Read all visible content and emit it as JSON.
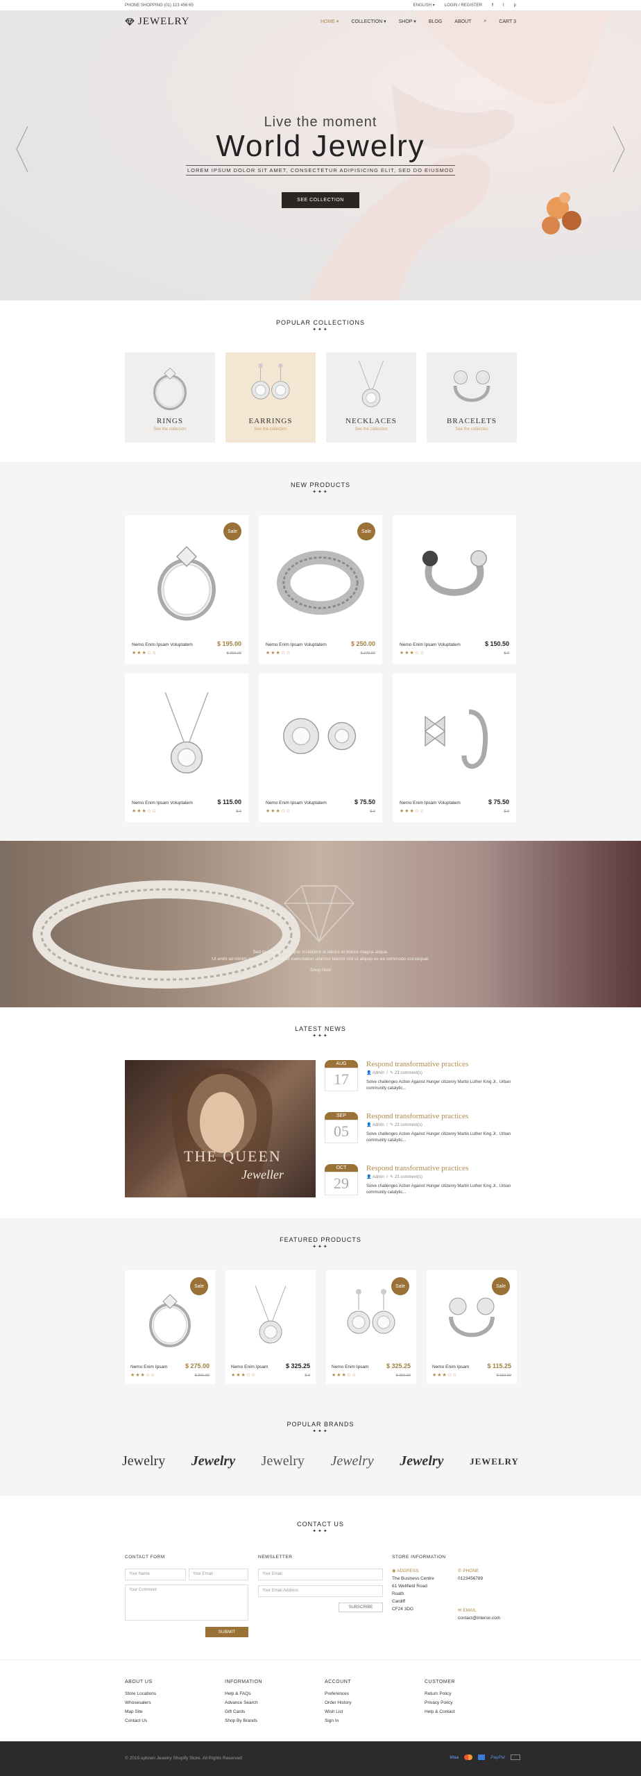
{
  "topbar": {
    "phone": "PHONE SHOPPING (01) 123 456 65",
    "language": "ENGLISH",
    "login": "LOGIN / REGISTER"
  },
  "logo": {
    "text": "JEWELRY"
  },
  "menu": {
    "home": "HOME",
    "collection": "COLLECTION",
    "shop": "SHOP",
    "blog": "BLOG",
    "about": "ABOUT",
    "cart": "CART",
    "cart_count": "3"
  },
  "hero": {
    "subtitle": "Live the moment",
    "title": "World Jewelry",
    "tagline": "LOREM IPSUM DOLOR SIT AMET, CONSECTETUR ADIPISICING ELIT, SED DO EIUSMOD",
    "button": "SEE COLLECTION"
  },
  "popular_collections": {
    "title": "POPULAR COLLECTIONS",
    "items": [
      {
        "name": "RINGS",
        "link": "See the collection"
      },
      {
        "name": "EARRINGS",
        "link": "See the collection"
      },
      {
        "name": "NECKLACES",
        "link": "See the collection"
      },
      {
        "name": "BRACELETS",
        "link": "See the collection"
      }
    ]
  },
  "new_products": {
    "title": "NEW PRODUCTS",
    "items": [
      {
        "name": "Nemo Enim Ipsam Voluptatem",
        "price": "$ 195.00",
        "old": "$ 250.00",
        "badge": "Sale",
        "gold": true
      },
      {
        "name": "Nemo Enim Ipsam Voluptatem",
        "price": "$ 250.00",
        "old": "$ 270.00",
        "badge": "Sale",
        "gold": true
      },
      {
        "name": "Nemo Enim Ipsam Voluptatem",
        "price": "$ 150.50",
        "old": "$ 0",
        "badge": "",
        "gold": false
      },
      {
        "name": "Nemo Enim Ipsam Voluptatem",
        "price": "$ 115.00",
        "old": "$ 0",
        "badge": "",
        "gold": false
      },
      {
        "name": "Nemo Enim Ipsam Voluptatem",
        "price": "$ 75.50",
        "old": "$ 0",
        "badge": "",
        "gold": false
      },
      {
        "name": "Nemo Enim Ipsam Voluptatem",
        "price": "$ 75.50",
        "old": "$ 0",
        "badge": "",
        "gold": false
      }
    ]
  },
  "banner": {
    "line1": "Sed do eiusmod tempor incididunt ut labore et dolore magna aliqua.",
    "line2": "Ut enim ad minim veniam, quis nostrud exercitation ullamco laboris nisi ut aliquip ex ea commodo consequat.",
    "link": "Shop Now"
  },
  "latest_news": {
    "title": "LATEST NEWS",
    "image_text1": "THE QUEEN",
    "image_text2": "Jeweller",
    "items": [
      {
        "month": "AUG",
        "day": "17",
        "title": "Respond transformative practices",
        "author": "Admin",
        "comments": "23 comment(s)",
        "excerpt": "Solve challenges Action Against Hunger citizenry Martin Luther King Jr.. Urban community catalytic..."
      },
      {
        "month": "SEP",
        "day": "05",
        "title": "Respond transformative practices",
        "author": "Admin",
        "comments": "23 comment(s)",
        "excerpt": "Solve challenges Action Against Hunger citizenry Martin Luther King Jr.. Urban community catalytic..."
      },
      {
        "month": "OCT",
        "day": "29",
        "title": "Respond transformative practices",
        "author": "Admin",
        "comments": "23 comment(s)",
        "excerpt": "Solve challenges Action Against Hunger citizenry Martin Luther King Jr.. Urban community catalytic..."
      }
    ]
  },
  "featured_products": {
    "title": "FEATURED PRODUCTS",
    "items": [
      {
        "name": "Nemo Enim Ipsam",
        "price": "$ 275.00",
        "old": "$ 300.00",
        "badge": "Sale",
        "gold": true
      },
      {
        "name": "Nemo Enim Ipsam",
        "price": "$ 325.25",
        "old": "$ 0",
        "badge": "",
        "gold": false
      },
      {
        "name": "Nemo Enim Ipsam",
        "price": "$ 325.25",
        "old": "$ 350.00",
        "badge": "Sale",
        "gold": true
      },
      {
        "name": "Nemo Enim Ipsam",
        "price": "$ 115.25",
        "old": "$ 150.00",
        "badge": "Sale",
        "gold": true
      }
    ]
  },
  "popular_brands": {
    "title": "POPULAR BRANDS",
    "items": [
      "Jewelry",
      "Jewelry",
      "Jewelry",
      "Jewelry",
      "Jewelry",
      "JEWELRY"
    ]
  },
  "contact": {
    "title": "CONTACT US",
    "form_label": "CONTACT FORM",
    "name_ph": "Your Name",
    "email_ph": "Your Email",
    "comment_ph": "Your Comment",
    "submit": "SUBMIT",
    "newsletter_label": "NEWSLETTER",
    "nl_email_ph": "Your Email",
    "nl_address_ph": "Your Email Address",
    "subscribe": "SUBSCRIBE",
    "store_label": "STORE INFORMATION",
    "address_label": "ADDRESS",
    "address": [
      "The Business Centre",
      "61 Wellfield Road",
      "Roath",
      "Cardiff",
      "CF24 3DG"
    ],
    "phone_label": "PHONE",
    "phone": "0123456789",
    "email_label": "EMAIL",
    "email": "contact@interior.com"
  },
  "footer": {
    "cols": [
      {
        "title": "ABOUT US",
        "links": [
          "Store Locations",
          "Whosesalers",
          "Map Site",
          "Contact Us"
        ]
      },
      {
        "title": "INFORMATION",
        "links": [
          "Help & FAQs",
          "Advance Search",
          "Gift Cards",
          "Shop By Brands"
        ]
      },
      {
        "title": "ACCOUNT",
        "links": [
          "Preferences",
          "Order History",
          "Wish List",
          "Sign In"
        ]
      },
      {
        "title": "CUSTOMER",
        "links": [
          "Return Policy",
          "Privacy Policy",
          "Help & Contact"
        ]
      }
    ],
    "copyright": "© 2015 uptown Jewelry Shopify Store. All Rights Reserved",
    "payments": [
      "Visa",
      "",
      "",
      "PayPal",
      ""
    ]
  }
}
